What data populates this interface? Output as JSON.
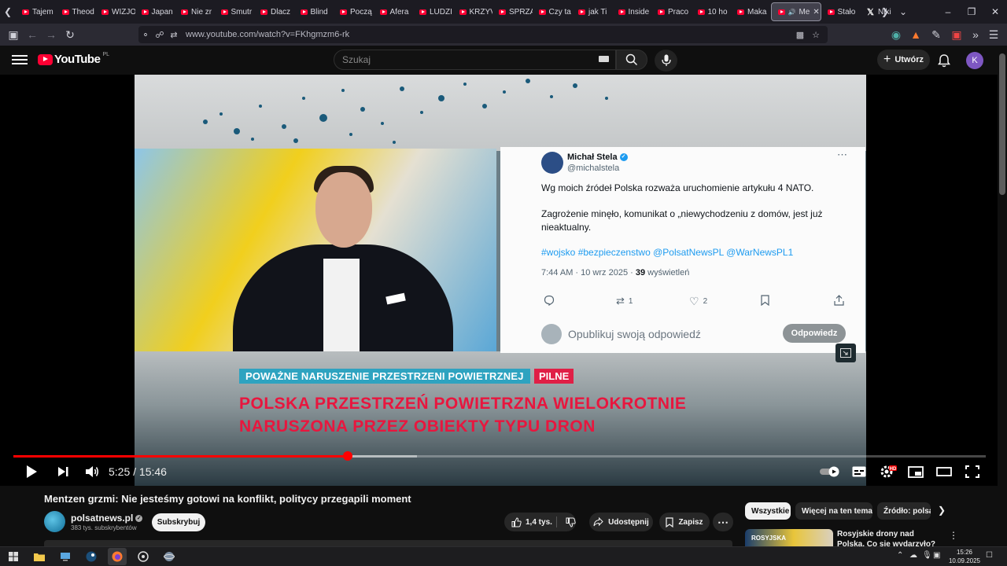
{
  "browser": {
    "tabs": [
      {
        "label": "Tajem",
        "active": false
      },
      {
        "label": "Theod",
        "active": false
      },
      {
        "label": "WIZJO",
        "active": false
      },
      {
        "label": "Japan",
        "active": false
      },
      {
        "label": "Nie zr",
        "active": false
      },
      {
        "label": "Smutr",
        "active": false
      },
      {
        "label": "Dlacz",
        "active": false
      },
      {
        "label": "Blind",
        "active": false
      },
      {
        "label": "Począ",
        "active": false
      },
      {
        "label": "Afera",
        "active": false
      },
      {
        "label": "LUDZI",
        "active": false
      },
      {
        "label": "KRZYV",
        "active": false
      },
      {
        "label": "SPRZA",
        "active": false
      },
      {
        "label": "Czy ta",
        "active": false
      },
      {
        "label": "jak Ti",
        "active": false
      },
      {
        "label": "Inside",
        "active": false
      },
      {
        "label": "Praco",
        "active": false
      },
      {
        "label": "10 ho",
        "active": false
      },
      {
        "label": "Maka",
        "active": false
      },
      {
        "label": "Me",
        "active": true
      },
      {
        "label": "Stało",
        "active": false
      },
      {
        "label": "Niki",
        "active": false
      }
    ],
    "url": "www.youtube.com/watch?v=FKhgmzm6-rk"
  },
  "youtube": {
    "logo_text": "YouTube",
    "region": "PL",
    "search_placeholder": "Szukaj",
    "create_label": "Utwórz",
    "avatar_letter": "K",
    "colors": {
      "brand_red": "#ff0033",
      "progress_red": "#ff0000",
      "avatar": "#7e57c2"
    }
  },
  "video": {
    "tweet": {
      "name": "Michał Stela",
      "handle": "@michalstela",
      "line1": "Wg moich źródeł Polska rozważa uruchomienie artykułu 4 NATO.",
      "line2": "Zagrożenie minęło, komunikat o „niewychodzeniu  z domów, jest już",
      "line3": "nieaktualny.",
      "hashtags": "#wojsko #bezpieczenstwo @PolsatNewsPL @WarNewsPL1",
      "meta_time": "7:44 AM · 10 wrz 2025 · ",
      "meta_views": "39",
      "meta_views_label": " wyświetleń",
      "retweets": "1",
      "likes": "2",
      "reply_placeholder": "Opublikuj swoją odpowiedź",
      "reply_button": "Odpowiedz"
    },
    "lower_third": {
      "tag": "POWAŻNE NARUSZENIE PRZESTRZENI POWIETRZNEJ",
      "urgent": "PILNE",
      "headline1": "POLSKA PRZESTRZEŃ POWIETRZNA WIELOKROTNIE",
      "headline2": "NARUSZONA PRZEZ OBIEKTY TYPU DRON"
    },
    "time_current": "5:25",
    "time_total": "15:46",
    "time_display": "5:25 / 15:46",
    "played_fraction": 0.344,
    "buffered_fraction": 0.415
  },
  "watch": {
    "title": "Mentzen grzmi: Nie jesteśmy gotowi na konflikt, politycy przegapili moment",
    "channel_name": "polsatnews.pl",
    "channel_subs": "383 tys. subskrybentów",
    "subscribe_label": "Subskrybuj",
    "likes": "1,4 tys.",
    "share_label": "Udostępnij",
    "save_label": "Zapisz",
    "chips": [
      "Wszystkie",
      "Więcej na ten temat",
      "Źródło: polsa"
    ],
    "recommended": {
      "thumb_label": "ROSYJSKA",
      "title": "Rosyjskie drony nad Polską. Co się wydarzyło? Co chce"
    }
  },
  "taskbar": {
    "time": "15:26",
    "date": "10.09.2025"
  }
}
